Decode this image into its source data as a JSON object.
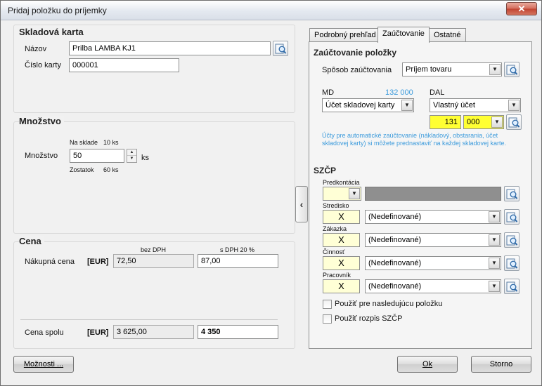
{
  "window": {
    "title": "Pridaj položku do príjemky",
    "close_glyph": "✕"
  },
  "skladova_karta": {
    "title": "Skladová karta",
    "nazov_label": "Názov",
    "nazov_value": "Prilba LAMBA KJ1",
    "cislo_label": "Číslo karty",
    "cislo_value": "000001"
  },
  "mnozstvo": {
    "title": "Množstvo",
    "na_sklade_label": "Na sklade",
    "na_sklade_value": "10 ks",
    "label": "Množstvo",
    "value": "50",
    "unit": "ks",
    "zostatok_label": "Zostatok",
    "zostatok_value": "60 ks"
  },
  "cena": {
    "title": "Cena",
    "bez_dph_label": "bez DPH",
    "s_dph_label": "s DPH 20 %",
    "nakupna_label": "Nákupná cena",
    "currency": "[EUR]",
    "nakupna_bez": "72,50",
    "nakupna_s": "87,00",
    "spolu_label": "Cena spolu",
    "spolu_bez": "3 625,00",
    "spolu_s": "4 350"
  },
  "tabs": [
    {
      "label": "Podrobný prehľad"
    },
    {
      "label": "Zaúčtovanie"
    },
    {
      "label": "Ostatné"
    }
  ],
  "zauctovanie": {
    "title": "Zaúčtovanie položky",
    "sposob_label": "Spôsob zaúčtovania",
    "sposob_value": "Príjem tovaru",
    "md_label": "MD",
    "md_amount": "132 000",
    "md_value": "Účet skladovej karty",
    "dal_label": "DAL",
    "dal_value": "Vlastný účet",
    "dal_ucet": "131",
    "dal_analytika": "000",
    "info": "Účty pre automatické zaúčtovanie (nákladový, obstarania, účet skladovej karty) si môžete prednastaviť na každej skladovej karte."
  },
  "szcp": {
    "title": "SZČP",
    "predkontacia_label": "Predkontácia",
    "predkontacia_value": "",
    "x_glyph": "X",
    "stredisko_label": "Stredisko",
    "stredisko_value": "(Nedefinované)",
    "zakazka_label": "Zákazka",
    "zakazka_value": "(Nedefinované)",
    "cinnost_label": "Činnosť",
    "cinnost_value": "(Nedefinované)",
    "pracovnik_label": "Pracovník",
    "pracovnik_value": "(Nedefinované)",
    "pouzit_label": "Použiť pre nasledujúcu položku",
    "rozpis_label": "Použiť rozpis SZČP"
  },
  "buttons": {
    "moznosti": "Možnosti ...",
    "ok": "Ok",
    "storno": "Storno"
  },
  "glyphs": {
    "dropdown": "▼",
    "spin_up": "▲",
    "spin_down": "▼",
    "collapse": "‹"
  },
  "icons": {
    "search": "magnifier-card-icon"
  }
}
